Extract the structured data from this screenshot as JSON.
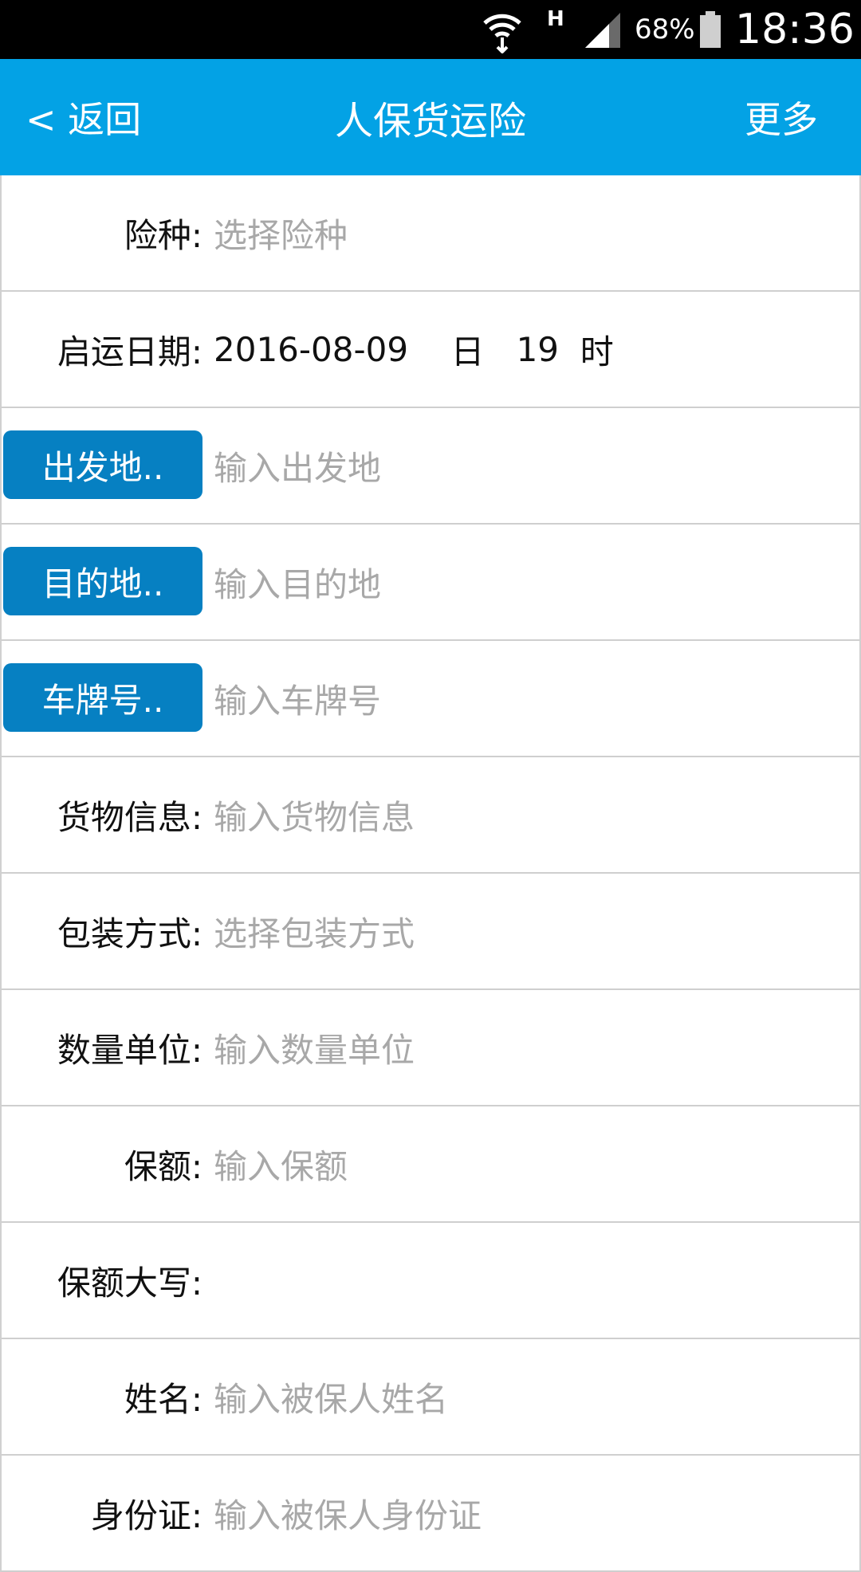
{
  "status_bar": {
    "network_type": "H",
    "battery": "68%",
    "time": "18:36",
    "icons": [
      "wifi-icon",
      "signal-icon",
      "battery-icon"
    ]
  },
  "header": {
    "back_label": "< 返回",
    "title": "人保货运险",
    "more_label": "更多",
    "background_color": "#03a2e5"
  },
  "form": {
    "insurance_type": {
      "label": "险种:",
      "placeholder": "选择险种"
    },
    "departure_date": {
      "label": "启运日期:",
      "date": "2016-08-09",
      "day_unit": "日",
      "hour": "19",
      "hour_unit": "时"
    },
    "origin": {
      "button_label": "出发地..",
      "placeholder": "输入出发地"
    },
    "destination": {
      "button_label": "目的地..",
      "placeholder": "输入目的地"
    },
    "plate_number": {
      "button_label": "车牌号..",
      "placeholder": "输入车牌号"
    },
    "cargo_info": {
      "label": "货物信息:",
      "placeholder": "输入货物信息"
    },
    "packaging": {
      "label": "包装方式:",
      "placeholder": "选择包装方式"
    },
    "quantity_unit": {
      "label": "数量单位:",
      "placeholder": "输入数量单位"
    },
    "insured_amount": {
      "label": "保额:",
      "placeholder": "输入保额"
    },
    "amount_in_words": {
      "label": "保额大写:",
      "value": ""
    },
    "insured_name": {
      "label": "姓名:",
      "placeholder": "输入被保人姓名"
    },
    "id_card": {
      "label": "身份证:",
      "placeholder": "输入被保人身份证"
    }
  },
  "colors": {
    "button_blue": "#0680c2",
    "placeholder_gray": "#a8a8a8"
  }
}
